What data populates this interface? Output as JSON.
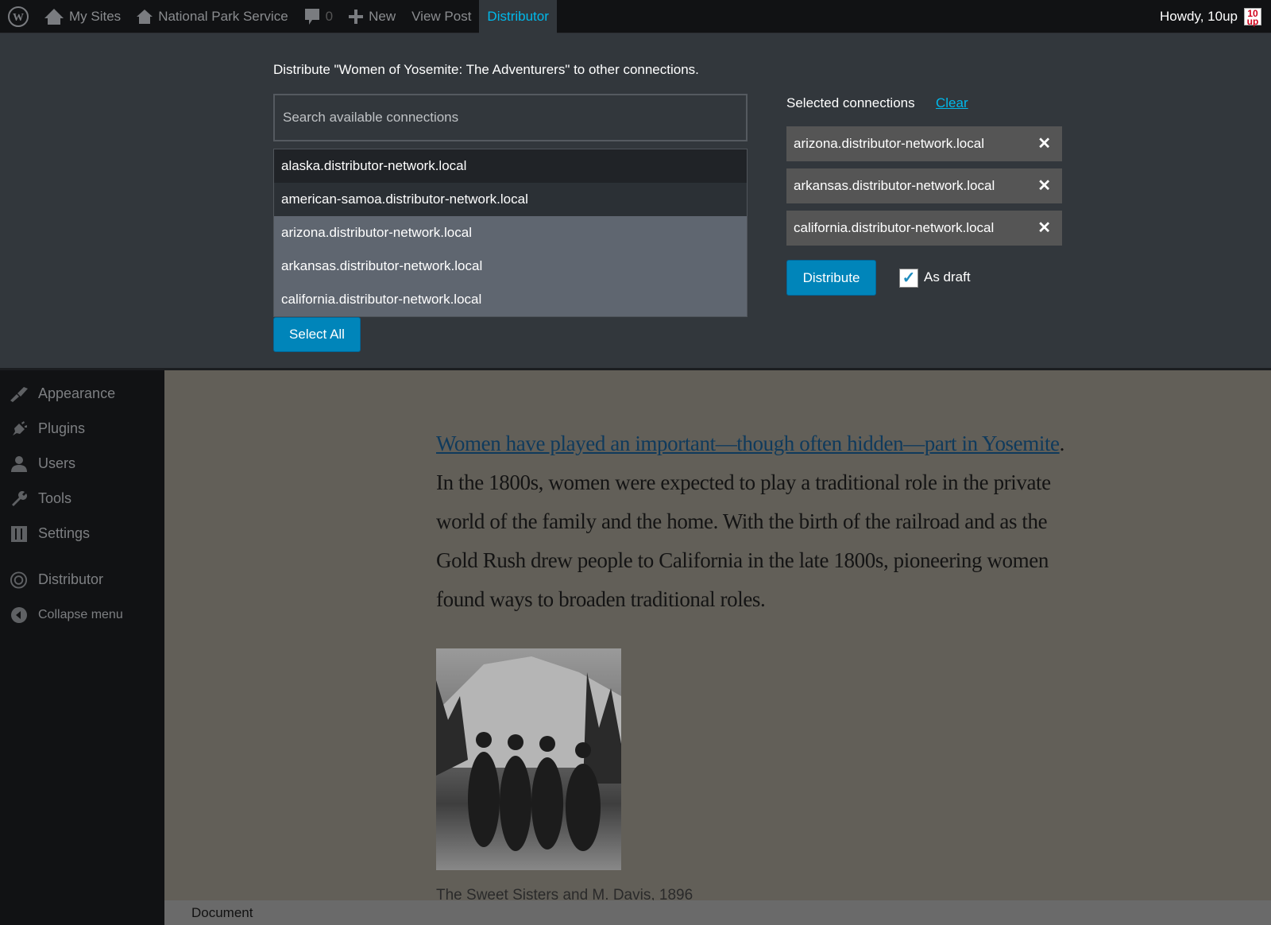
{
  "adminbar": {
    "my_sites": "My Sites",
    "site_name": "National Park Service",
    "comments": "0",
    "new": "New",
    "view_post": "View Post",
    "distributor": "Distributor",
    "howdy": "Howdy, 10up",
    "avatar_text": "10up"
  },
  "panel": {
    "heading": "Distribute \"Women of Yosemite: The Adventurers\" to other connections.",
    "search_placeholder": "Search available connections",
    "connections": [
      "alaska.distributor-network.local",
      "american-samoa.distributor-network.local",
      "arizona.distributor-network.local",
      "arkansas.distributor-network.local",
      "california.distributor-network.local"
    ],
    "select_all": "Select All",
    "selected_label": "Selected connections",
    "clear": "Clear",
    "selected": [
      "arizona.distributor-network.local",
      "arkansas.distributor-network.local",
      "california.distributor-network.local"
    ],
    "remove_glyph": "✕",
    "distribute": "Distribute",
    "as_draft": "As draft",
    "as_draft_checked": true,
    "accent": "#0085ba",
    "link_color": "#00b9eb"
  },
  "sidebar": {
    "items": [
      {
        "label": "Appearance",
        "icon": "paintbrush-icon"
      },
      {
        "label": "Plugins",
        "icon": "plugin-icon"
      },
      {
        "label": "Users",
        "icon": "user-icon"
      },
      {
        "label": "Tools",
        "icon": "wrench-icon"
      },
      {
        "label": "Settings",
        "icon": "settings-icon"
      },
      {
        "label": "Distributor",
        "icon": "distributor-icon"
      },
      {
        "label": "Collapse menu",
        "icon": "collapse-icon"
      }
    ]
  },
  "content": {
    "link_text": "Women have played an important—though often hidden—part in Yosemite",
    "body_text": ". In the 1800s, women were expected to play a traditional role in the private world of the family and the home. With the birth of the railroad and as the Gold Rush drew people to California in the late 1800s, pioneering women found ways to broaden traditional roles.",
    "caption": "The Sweet Sisters and M. Davis, 1896"
  },
  "bottombar": {
    "label": "Document"
  }
}
